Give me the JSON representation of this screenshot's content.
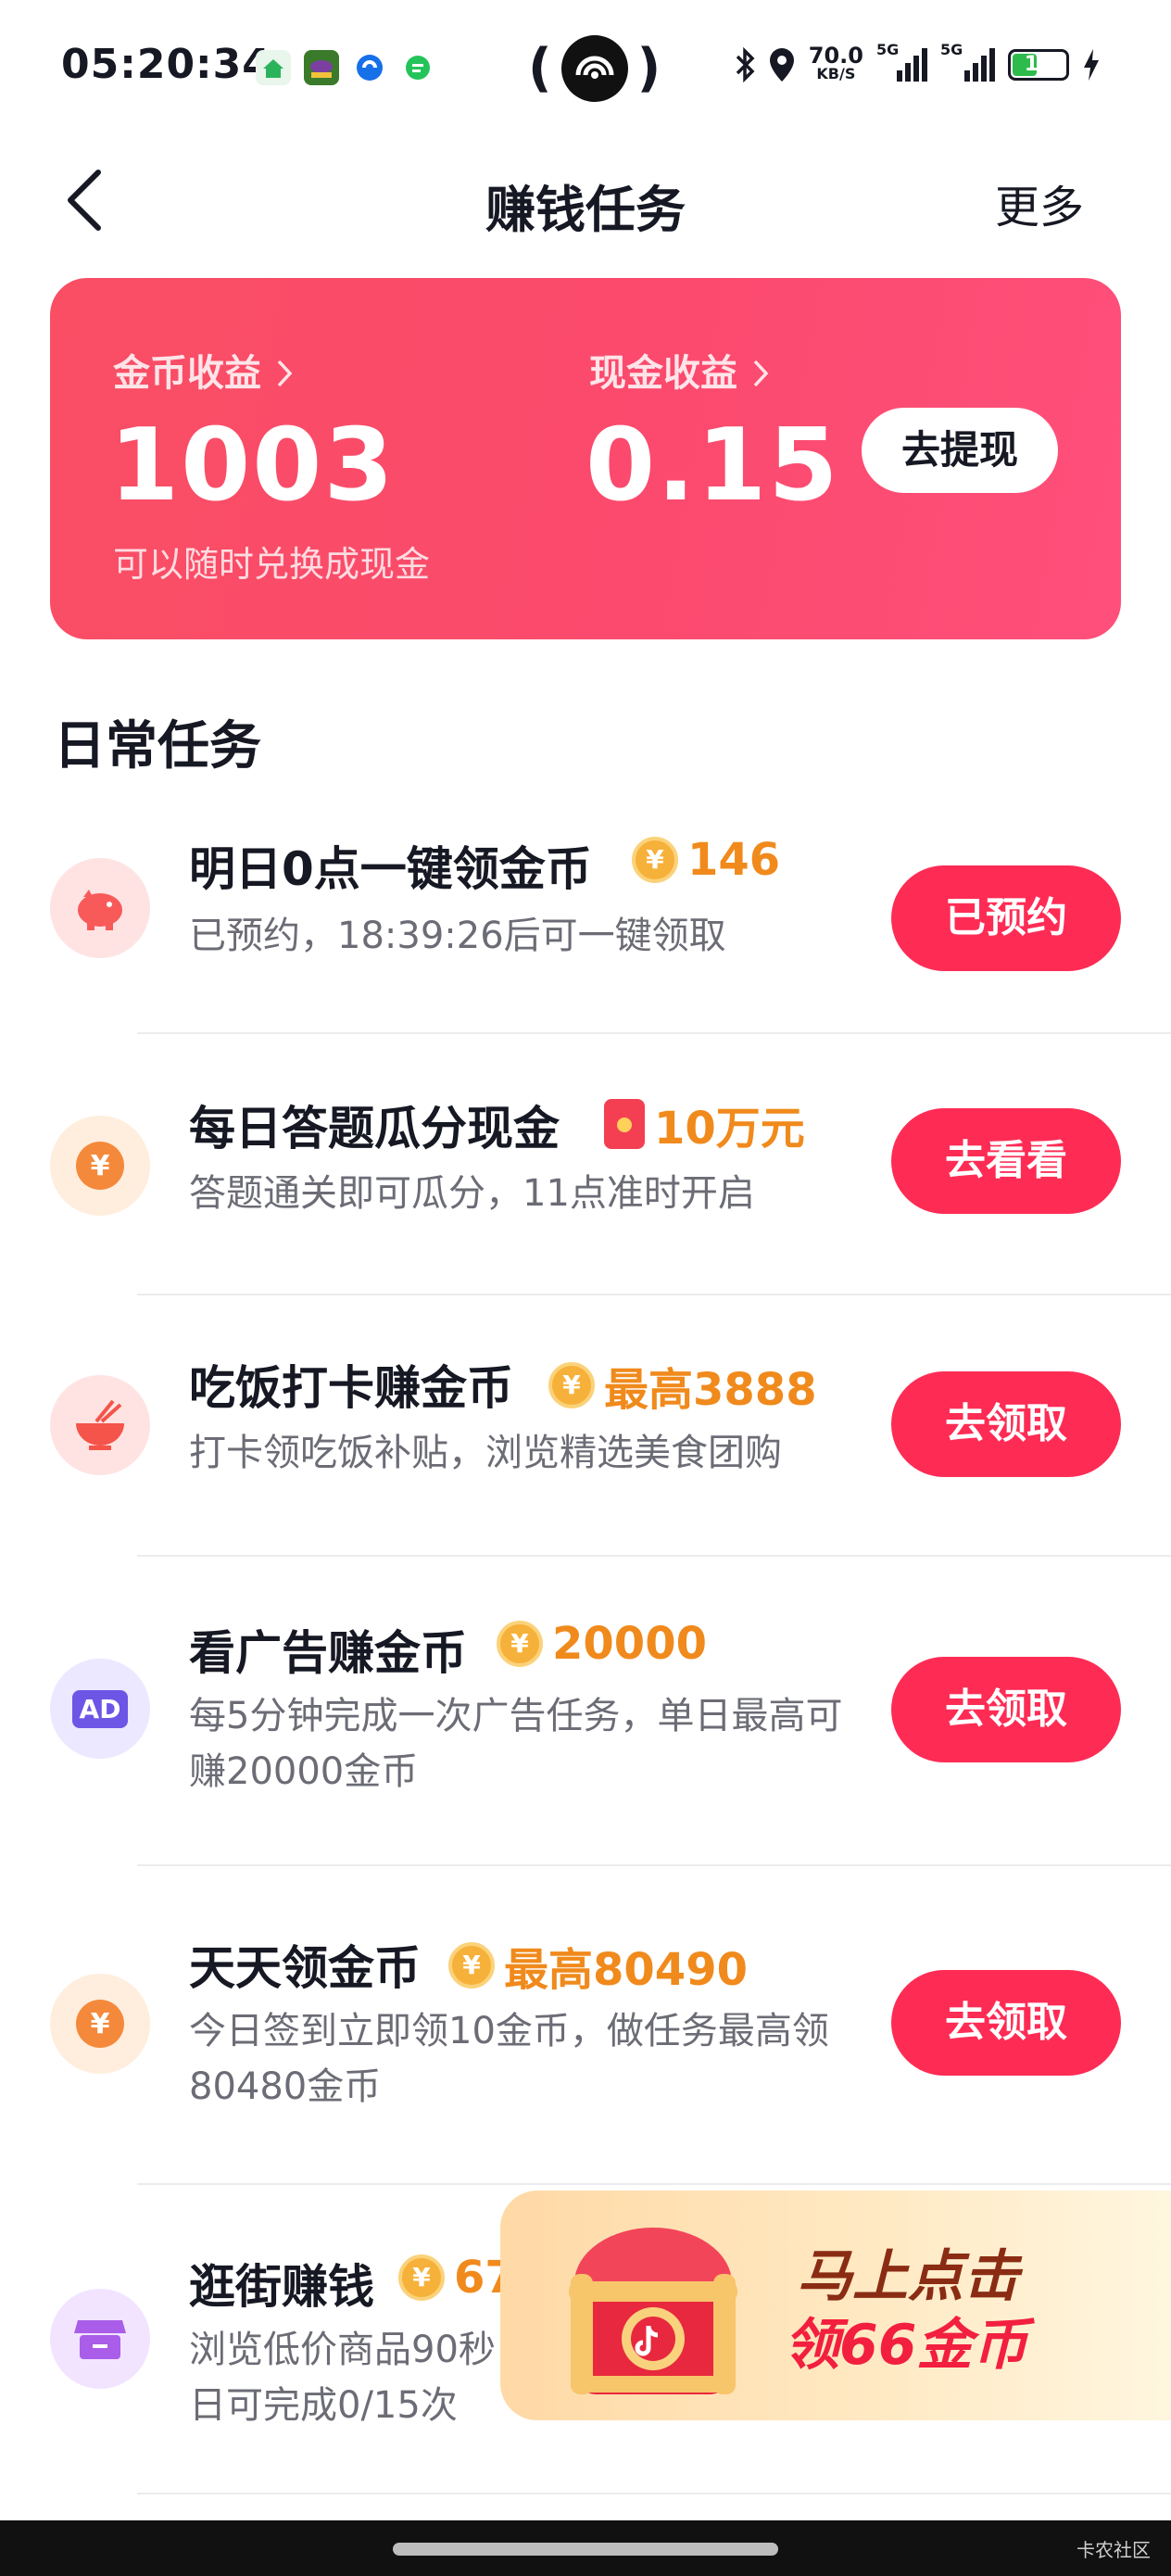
{
  "status_bar": {
    "time": "05:20:34",
    "app_icons": [
      "anjuke-app-icon",
      "game-app-icon",
      "blue-app-icon",
      "green-app-icon"
    ],
    "speed_value": "70.0",
    "speed_unit": "KB/S",
    "network_1": "5G",
    "network_2": "5G",
    "battery_level": "19"
  },
  "header": {
    "title": "赚钱任务",
    "more_label": "更多"
  },
  "earnings": {
    "coin_label": "金币收益",
    "coin_value": "1003",
    "coin_sub": "可以随时兑换成现金",
    "cash_label": "现金收益",
    "cash_value": "0.15",
    "withdraw_label": "去提现"
  },
  "section_title": "日常任务",
  "tasks": [
    {
      "icon": "piggy-bank-icon",
      "title": "明日0点一键领金币",
      "reward": "146",
      "desc": "已预约，18:39:26后可一键领取",
      "action": "已预约"
    },
    {
      "icon": "yuan-coin-icon",
      "title": "每日答题瓜分现金",
      "reward": "10万元",
      "desc": "答题通关即可瓜分，11点准时开启",
      "action": "去看看"
    },
    {
      "icon": "rice-bowl-icon",
      "title": "吃饭打卡赚金币",
      "reward": "最高3888",
      "desc": "打卡领吃饭补贴，浏览精选美食团购",
      "action": "去领取"
    },
    {
      "icon": "ad-icon",
      "icon_text": "AD",
      "title": "看广告赚金币",
      "reward": "20000",
      "desc": "每5分钟完成一次广告任务，单日最高可赚20000金币",
      "action": "去领取"
    },
    {
      "icon": "yuan-coin-icon",
      "title": "天天领金币",
      "reward": "最高80490",
      "desc": "今日签到立即领10金币，做任务最高领80480金币",
      "action": "去领取"
    },
    {
      "icon": "shop-icon",
      "title": "逛街赚钱",
      "reward": "67",
      "desc": "浏览低价商品90秒",
      "desc2": "日可完成0/15次"
    }
  ],
  "promo": {
    "line1": "马上点击",
    "line2": "领66金币"
  },
  "watermark": "卡农社区",
  "colors": {
    "accent": "#fe2c55",
    "card_gradient_start": "#f94e64",
    "card_gradient_end": "#ff4f7b",
    "reward_orange": "#f08a1c"
  }
}
